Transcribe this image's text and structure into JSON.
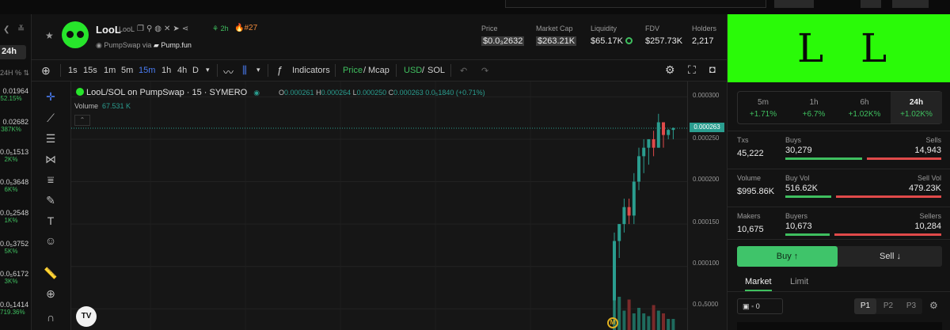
{
  "colors": {
    "green": "#3fbf5f",
    "red": "#e04a4a",
    "teal": "#2a9d8f",
    "accent_blue": "#4a7cf2",
    "banner": "#2afa08",
    "background": "#131313"
  },
  "left_panel": {
    "period": "24h",
    "sort_label": "24H % ⇅",
    "rows": [
      {
        "value": "0.01964",
        "change": "52.15%"
      },
      {
        "value": "0.02682",
        "change": "387K%"
      },
      {
        "value": "0.0₅1513",
        "change": "2K%"
      },
      {
        "value": "0.0₅3648",
        "change": "6K%"
      },
      {
        "value": "0.0₅2548",
        "change": "1K%"
      },
      {
        "value": "0.0₅3752",
        "change": "5K%"
      },
      {
        "value": "0.0₅6172",
        "change": "3K%"
      },
      {
        "value": "0.0₅1414",
        "change": "719.36%"
      }
    ]
  },
  "header": {
    "token_name": "LooL",
    "token_symbol": "LooL",
    "age": "2h",
    "rank": "#27",
    "via_prefix": "PumpSwap via",
    "via_source": "Pump.fun",
    "stats": [
      {
        "label": "Price",
        "value": "$0.0₃2632"
      },
      {
        "label": "Market Cap",
        "value": "$263.21K"
      },
      {
        "label": "Liquidity",
        "value": "$65.17K"
      },
      {
        "label": "FDV",
        "value": "$257.73K"
      },
      {
        "label": "Holders",
        "value": "2,217"
      }
    ]
  },
  "toolbar": {
    "intervals": [
      "1s",
      "15s",
      "1m",
      "5m",
      "15m",
      "1h",
      "4h",
      "D"
    ],
    "active_interval": "15m",
    "indicators": "Indicators",
    "price_label": "Price",
    "mcap_label": "Mcap",
    "usd_label": "USD",
    "sol_label": "SOL"
  },
  "chart_data": {
    "type": "candlestick",
    "title": "LooL/SOL on PumpSwap · 15 · SYMERO",
    "ohlc": {
      "open": "0.000261",
      "high": "0.000264",
      "low": "0.000250",
      "close": "0.000263",
      "change": "0.0₅1840 (+0.71%)"
    },
    "volume": "67.531 K",
    "y_ticks": [
      "0.000300",
      "0.000250",
      "0.000200",
      "0.000150",
      "0.000100",
      "0.0₄5000"
    ],
    "ylim": [
      4e-05,
      0.000305
    ],
    "last_price": "0.000263",
    "last_price_value": 0.000263,
    "candles": [
      {
        "o": 6e-05,
        "h": 0.00014,
        "l": 4e-05,
        "c": 0.00013
      },
      {
        "o": 0.00013,
        "h": 0.00015,
        "l": 0.00011,
        "c": 0.00015
      },
      {
        "o": 0.00015,
        "h": 0.00018,
        "l": 0.00014,
        "c": 0.00017
      },
      {
        "o": 0.00017,
        "h": 0.00018,
        "l": 0.00015,
        "c": 0.00016
      },
      {
        "o": 0.00016,
        "h": 0.00021,
        "l": 0.00015,
        "c": 0.0002
      },
      {
        "o": 0.0002,
        "h": 0.00024,
        "l": 0.00019,
        "c": 0.00023
      },
      {
        "o": 0.00023,
        "h": 0.00025,
        "l": 0.00021,
        "c": 0.00024
      },
      {
        "o": 0.00024,
        "h": 0.00025,
        "l": 0.00022,
        "c": 0.00025
      },
      {
        "o": 0.00025,
        "h": 0.00026,
        "l": 0.00023,
        "c": 0.00024
      },
      {
        "o": 0.00024,
        "h": 0.00028,
        "l": 0.00024,
        "c": 0.00027
      },
      {
        "o": 0.00027,
        "h": 0.00027,
        "l": 0.00024,
        "c": 0.000255
      },
      {
        "o": 0.000255,
        "h": 0.000262,
        "l": 0.00025,
        "c": 0.000261
      },
      {
        "o": 0.000261,
        "h": 0.000264,
        "l": 0.00025,
        "c": 0.000263
      }
    ],
    "volumes": [
      0.9,
      0.6,
      0.35,
      0.55,
      0.3,
      0.4,
      0.3,
      0.25,
      0.45,
      0.35,
      0.3,
      0.2,
      0.2
    ],
    "volume_colors": [
      "green",
      "green",
      "green",
      "red",
      "green",
      "green",
      "green",
      "green",
      "red",
      "green",
      "red",
      "green",
      "green"
    ]
  },
  "metrics": {
    "timeframes": [
      {
        "label": "5m",
        "change": "+1.71%"
      },
      {
        "label": "1h",
        "change": "+6.7%"
      },
      {
        "label": "6h",
        "change": "+1.02K%"
      },
      {
        "label": "24h",
        "change": "+1.02K%"
      }
    ],
    "txs": {
      "label": "Txs",
      "value": "45,222",
      "left_label": "Buys",
      "left_value": "30,279",
      "right_label": "Sells",
      "right_value": "14,943",
      "buy_fraction": 0.67
    },
    "volume": {
      "label": "Volume",
      "value": "$995.86K",
      "left_label": "Buy Vol",
      "left_value": "516.62K",
      "right_label": "Sell Vol",
      "right_value": "479.23K",
      "buy_fraction": 0.52
    },
    "makers": {
      "label": "Makers",
      "value": "10,675",
      "left_label": "Buyers",
      "left_value": "10,673",
      "right_label": "Sellers",
      "right_value": "10,284",
      "buy_fraction": 0.51
    }
  },
  "trade": {
    "buy_label": "Buy ↑",
    "sell_label": "Sell ↓",
    "market_tab": "Market",
    "limit_tab": "Limit",
    "wallet_count": "0",
    "presets": [
      "P1",
      "P2",
      "P3"
    ]
  },
  "icons": [
    "star-icon",
    "copy-icon",
    "search-icon",
    "globe-icon",
    "x-icon",
    "telegram-icon",
    "share-icon",
    "crosshair-icon",
    "line-icon",
    "fib-icon",
    "pattern-icon",
    "ruler-icon",
    "brush-icon",
    "text-icon",
    "emoji-icon",
    "zoom-icon",
    "magnet-icon",
    "gear-icon",
    "fullscreen-icon",
    "camera-icon"
  ]
}
